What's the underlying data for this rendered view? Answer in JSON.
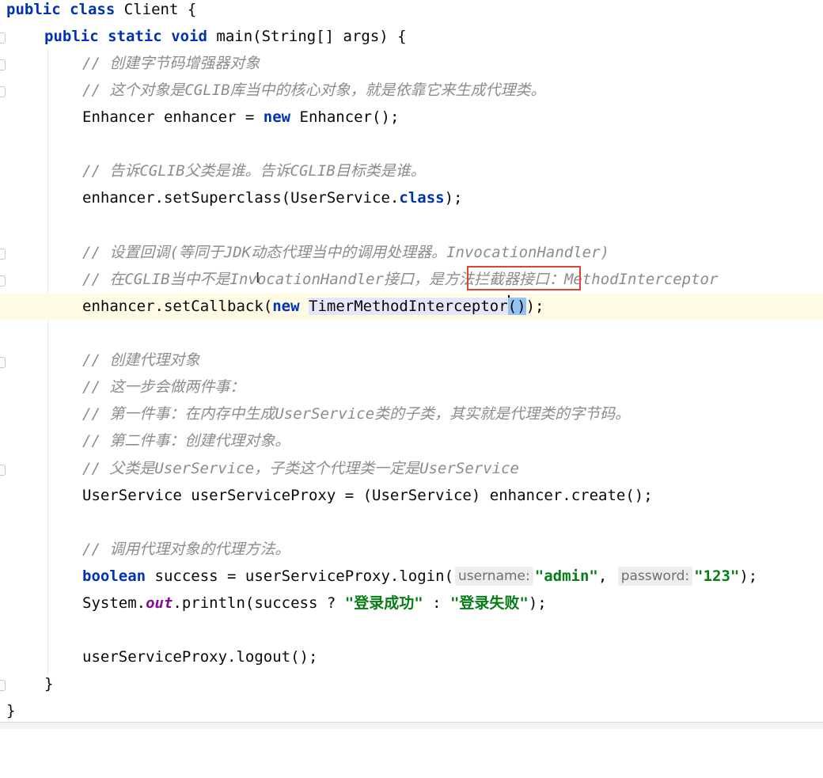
{
  "code": {
    "l1": {
      "kw1": "public",
      "kw2": "class",
      "name": "Client {"
    },
    "l2": {
      "kw1": "public",
      "kw2": "static",
      "kw3": "void",
      "rest": "main(String[] args) {"
    },
    "l3": "// 创建字节码增强器对象",
    "l4": "// 这个对象是CGLIB库当中的核心对象，就是依靠它来生成代理类。",
    "l5": {
      "a": "Enhancer enhancer = ",
      "kw": "new",
      "b": " Enhancer();"
    },
    "l7": "// 告诉CGLIB父类是谁。告诉CGLIB目标类是谁。",
    "l8": {
      "a": "enhancer.setSuperclass(UserService.",
      "kw": "class",
      "b": ");"
    },
    "l10": "// 设置回调(等同于JDK动态代理当中的调用处理器。InvocationHandler)",
    "l11": "// 在CGLIB当中不是InvocationHandler接口，是方法拦截器接口：MethodInterceptor",
    "l12": {
      "a": "enhancer.setCallback(",
      "kw": "new",
      "ident": "TimerMethodInterceptor",
      "paren": "()",
      "b": ");"
    },
    "l14": "// 创建代理对象",
    "l15": "// 这一步会做两件事：",
    "l16": "// 第一件事：在内存中生成UserService类的子类，其实就是代理类的字节码。",
    "l17": "// 第二件事：创建代理对象。",
    "l18": "// 父类是UserService，子类这个代理类一定是UserService",
    "l19": "UserService userServiceProxy = (UserService) enhancer.create();",
    "l21": "// 调用代理对象的代理方法。",
    "l22": {
      "kw": "boolean",
      "a": " success = userServiceProxy.login(",
      "hint1": "username:",
      "s1": "\"admin\"",
      "comma": ", ",
      "hint2": "password:",
      "s2": "\"123\"",
      "b": ");"
    },
    "l23": {
      "a": "System.",
      "field": "out",
      "b": ".println(success ? ",
      "s1": "\"登录成功\"",
      "c": " : ",
      "s2": "\"登录失败\"",
      "d": ");"
    },
    "l25": "userServiceProxy.logout();",
    "l26": "}",
    "l27": "}"
  }
}
